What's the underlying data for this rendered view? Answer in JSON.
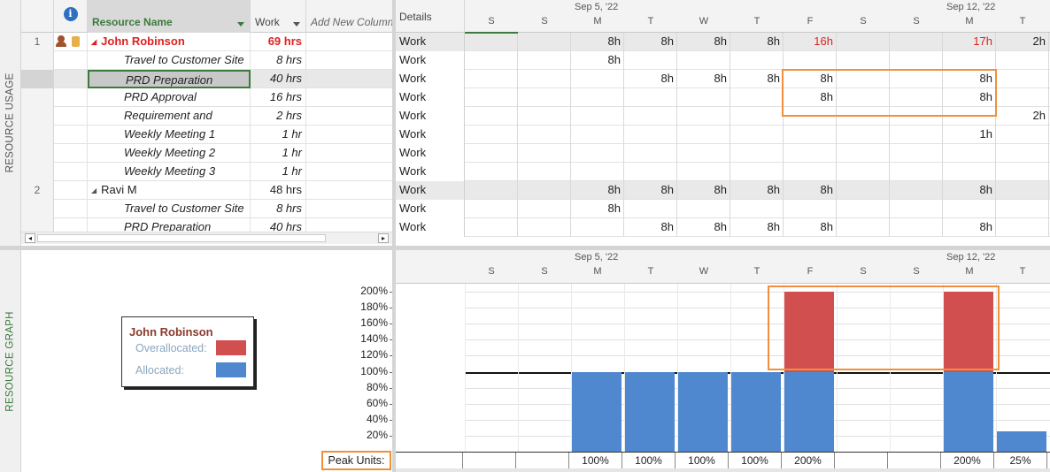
{
  "views": {
    "usage_label": "RESOURCE USAGE",
    "graph_label": "RESOURCE GRAPH"
  },
  "sheet": {
    "col_resource": "Resource Name",
    "col_work": "Work",
    "col_add": "Add New Column",
    "col_details": "Details",
    "rows": [
      {
        "id": "1",
        "name": "John Robinson",
        "work": "69 hrs",
        "detail": "Work",
        "type": "resource",
        "over": true
      },
      {
        "id": "",
        "name": "Travel to Customer Site",
        "work": "8 hrs",
        "detail": "Work",
        "type": "task"
      },
      {
        "id": "",
        "name": "PRD Preparation",
        "work": "40 hrs",
        "detail": "Work",
        "type": "task",
        "selected": true
      },
      {
        "id": "",
        "name": "PRD Approval",
        "work": "16 hrs",
        "detail": "Work",
        "type": "task"
      },
      {
        "id": "",
        "name": "Requirement and",
        "work": "2 hrs",
        "detail": "Work",
        "type": "task"
      },
      {
        "id": "",
        "name": "Weekly Meeting 1",
        "work": "1 hr",
        "detail": "Work",
        "type": "task"
      },
      {
        "id": "",
        "name": "Weekly Meeting 2",
        "work": "1 hr",
        "detail": "Work",
        "type": "task"
      },
      {
        "id": "",
        "name": "Weekly Meeting 3",
        "work": "1 hr",
        "detail": "Work",
        "type": "task"
      },
      {
        "id": "2",
        "name": "Ravi M",
        "work": "48 hrs",
        "detail": "Work",
        "type": "resource",
        "over": false
      },
      {
        "id": "",
        "name": "Travel to Customer Site",
        "work": "8 hrs",
        "detail": "Work",
        "type": "task"
      },
      {
        "id": "",
        "name": "PRD Preparation",
        "work": "40 hrs",
        "detail": "Work",
        "type": "task"
      }
    ]
  },
  "timescale": {
    "week1": "Sep 5, '22",
    "week2": "Sep 12, '22",
    "days": [
      "S",
      "S",
      "M",
      "T",
      "W",
      "T",
      "F",
      "S",
      "S",
      "M",
      "T"
    ]
  },
  "usage_grid": [
    [
      "",
      "",
      "8h",
      "8h",
      "8h",
      "8h",
      "16h",
      "",
      "",
      "17h",
      "2h"
    ],
    [
      "",
      "",
      "8h",
      "",
      "",
      "",
      "",
      "",
      "",
      "",
      ""
    ],
    [
      "",
      "",
      "",
      "8h",
      "8h",
      "8h",
      "8h",
      "",
      "",
      "8h",
      ""
    ],
    [
      "",
      "",
      "",
      "",
      "",
      "",
      "8h",
      "",
      "",
      "8h",
      ""
    ],
    [
      "",
      "",
      "",
      "",
      "",
      "",
      "",
      "",
      "",
      "",
      "2h"
    ],
    [
      "",
      "",
      "",
      "",
      "",
      "",
      "",
      "",
      "",
      "1h",
      ""
    ],
    [
      "",
      "",
      "",
      "",
      "",
      "",
      "",
      "",
      "",
      "",
      ""
    ],
    [
      "",
      "",
      "",
      "",
      "",
      "",
      "",
      "",
      "",
      "",
      ""
    ],
    [
      "",
      "",
      "8h",
      "8h",
      "8h",
      "8h",
      "8h",
      "",
      "",
      "8h",
      ""
    ],
    [
      "",
      "",
      "8h",
      "",
      "",
      "",
      "",
      "",
      "",
      "",
      ""
    ],
    [
      "",
      "",
      "",
      "8h",
      "8h",
      "8h",
      "8h",
      "",
      "",
      "8h",
      ""
    ]
  ],
  "over_cells": [
    [
      0,
      6
    ],
    [
      0,
      9
    ]
  ],
  "legend": {
    "title": "John Robinson",
    "over": "Overallocated:",
    "alloc": "Allocated:"
  },
  "colors": {
    "over": "#d14f4f",
    "alloc": "#4f88cf",
    "highlight": "#f0903a",
    "header_green": "#3b7a3b",
    "over_text": "#e02020"
  },
  "chart_data": {
    "type": "bar",
    "categories": [
      "S",
      "S",
      "M",
      "T",
      "W",
      "T",
      "F",
      "S",
      "S",
      "M",
      "T"
    ],
    "series": [
      {
        "name": "Allocated",
        "values": [
          0,
          0,
          100,
          100,
          100,
          100,
          100,
          0,
          0,
          100,
          25
        ]
      },
      {
        "name": "Overallocated",
        "values": [
          0,
          0,
          0,
          0,
          0,
          0,
          100,
          0,
          0,
          100,
          0
        ]
      }
    ],
    "ylim": [
      0,
      200
    ],
    "yticks": [
      "200%",
      "180%",
      "160%",
      "140%",
      "120%",
      "100%",
      "80%",
      "60%",
      "40%",
      "20%"
    ],
    "max_units_line": 100,
    "peak_label": "Peak Units:",
    "peak_units": [
      "",
      "",
      "100%",
      "100%",
      "100%",
      "100%",
      "200%",
      "",
      "",
      "200%",
      "25%"
    ]
  }
}
